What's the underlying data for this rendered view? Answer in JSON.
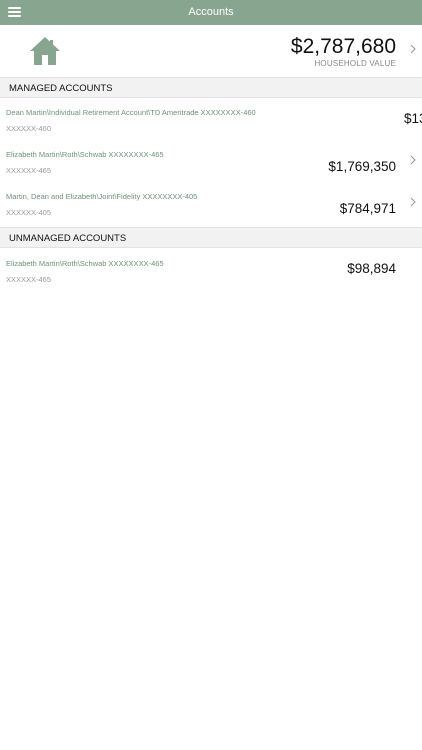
{
  "topbar": {
    "title": "Accounts",
    "menu_icon": "hamburger-menu-icon"
  },
  "household": {
    "icon": "home-icon",
    "value": "$2,787,680",
    "label": "HOUSEHOLD VALUE"
  },
  "managed": {
    "header": "MANAGED ACCOUNTS",
    "accounts": [
      {
        "name": "Dean Martin\\Individual Retirement Account\\TD Ameritrade XXXXXXXX-460",
        "number": "XXXXXX-460",
        "value": "$13"
      },
      {
        "name": "Elizabeth Martin\\Roth\\Schwab XXXXXXXX-465",
        "number": "XXXXXX-465",
        "value": "$1,769,350"
      },
      {
        "name": "Martin, Dean and Elizabeth\\Joint\\Fidelity XXXXXXXX-405",
        "number": "XXXXXX-405",
        "value": "$784,971"
      }
    ]
  },
  "unmanaged": {
    "header": "UNMANAGED ACCOUNTS",
    "accounts": [
      {
        "name": "Elizabeth Martin\\Roth\\Schwab XXXXXXXX-465",
        "number": "XXXXXX-465",
        "value": "$98,894"
      }
    ]
  },
  "colors": {
    "accent": "#88a58f",
    "link_text": "#6c9377",
    "section_bg": "#f2f2f2"
  }
}
